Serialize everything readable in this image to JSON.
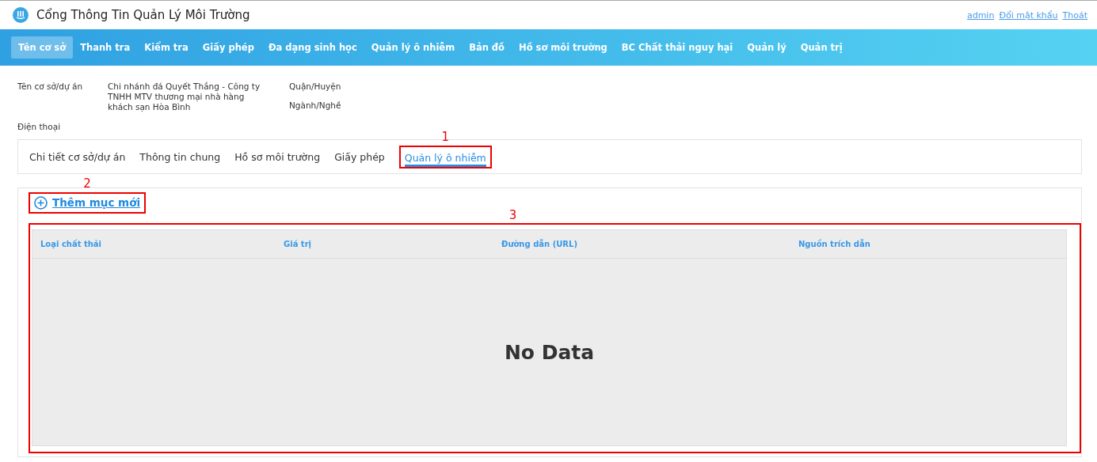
{
  "header": {
    "title": "Cổng Thông Tin Quản Lý Môi Trường",
    "user_links": [
      "admin",
      "Đổi mật khẩu",
      "Thoát"
    ]
  },
  "nav": [
    {
      "label": "Tên cơ sở",
      "selected": true
    },
    {
      "label": "Thanh tra",
      "selected": false
    },
    {
      "label": "Kiểm tra",
      "selected": false
    },
    {
      "label": "Giấy phép",
      "selected": false
    },
    {
      "label": "Đa dạng sinh học",
      "selected": false
    },
    {
      "label": "Quản lý ô nhiễm",
      "selected": false
    },
    {
      "label": "Bản đồ",
      "selected": false
    },
    {
      "label": "Hồ sơ môi trường",
      "selected": false
    },
    {
      "label": "BC Chất thải nguy hại",
      "selected": false
    },
    {
      "label": "Quản lý",
      "selected": false
    },
    {
      "label": "Quản trị",
      "selected": false
    }
  ],
  "info": {
    "left": [
      {
        "label": "Tên cơ sở/dự án",
        "value": "Chi nhánh đá Quyết Thắng - Công ty TNHH MTV thương mại nhà hàng khách sạn Hòa Bình"
      },
      {
        "label": "Điện thoại"
      }
    ],
    "right": [
      {
        "label": "Quận/Huyện"
      },
      {
        "label": "Ngành/Nghề"
      }
    ]
  },
  "tabs": {
    "callout": "1",
    "items": [
      {
        "label": "Chi tiết cơ sở/dự án",
        "selected": false
      },
      {
        "label": "Thông tin chung",
        "selected": false
      },
      {
        "label": "Hồ sơ môi trường",
        "selected": false
      },
      {
        "label": "Giấy phép",
        "selected": false
      },
      {
        "label": "Quản lý ô nhiễm",
        "selected": true
      }
    ]
  },
  "add_button": {
    "label": "Thêm mục mới",
    "callout": "2"
  },
  "table": {
    "callout": "3",
    "columns": [
      "Loại chất thải",
      "Giá trị",
      "Đường dẫn (URL)",
      "Nguồn trích dẫn"
    ],
    "empty_text": "No Data"
  }
}
